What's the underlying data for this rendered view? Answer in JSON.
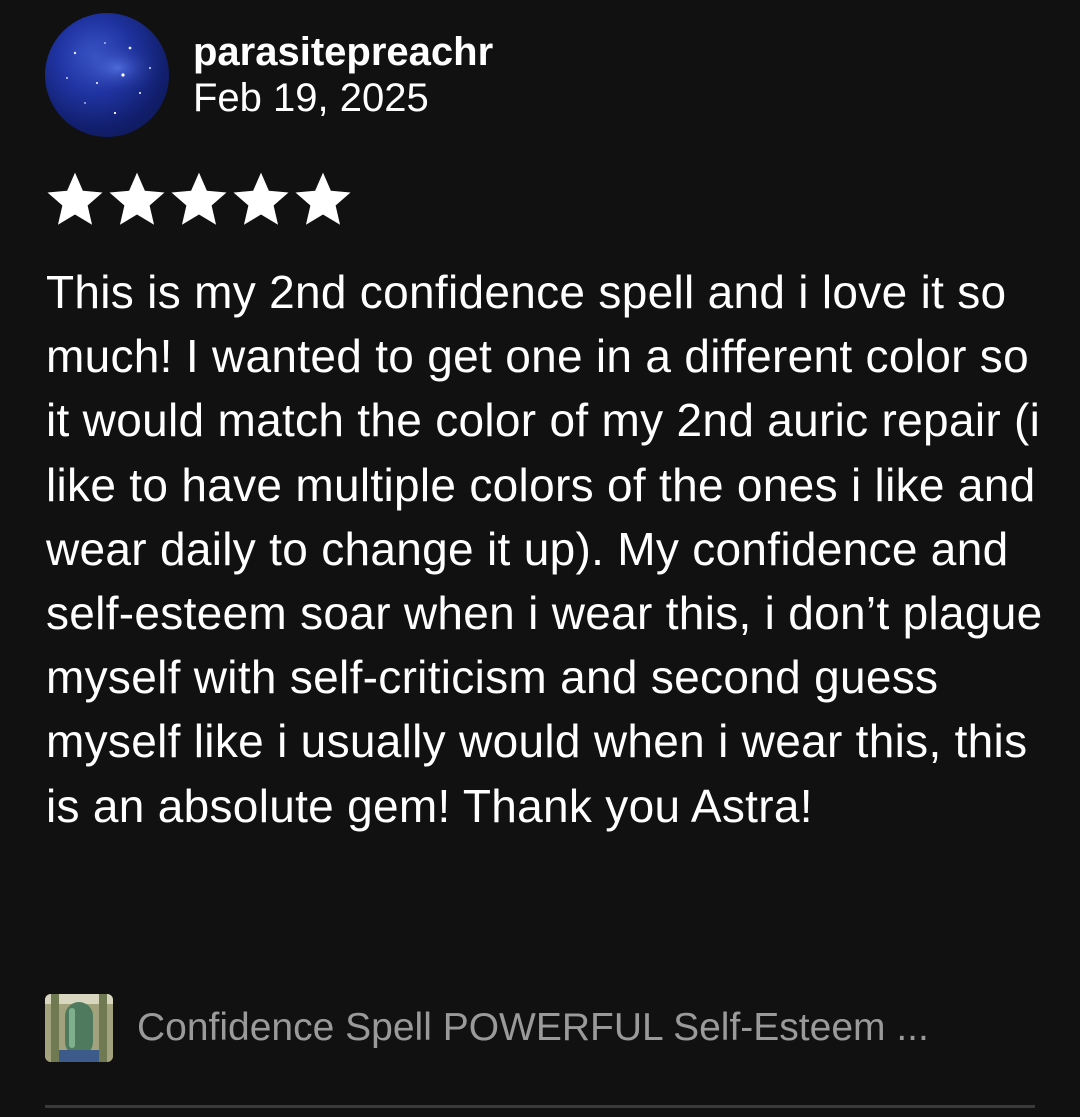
{
  "review": {
    "username": "parasitepreachr",
    "date": "Feb 19, 2025",
    "rating": 5,
    "rating_max": 5,
    "text": "This is my 2nd confidence spell and i love it so much! I wanted to get one in a different color so it would match the color of my 2nd auric repair (i like to have multiple colors of the ones i like and wear daily to change it up). My confidence and self-esteem soar when i wear this, i don’t plague myself with self-criticism and second guess myself like i usually would when i wear this, this is an absolute gem! Thank you Astra!"
  },
  "product": {
    "title": "Confidence Spell POWERFUL Self-Esteem ..."
  },
  "colors": {
    "background": "#111112",
    "text": "#ffffff",
    "muted_text": "#9a9a9a",
    "divider": "#3a3a3c",
    "star": "#ffffff"
  }
}
